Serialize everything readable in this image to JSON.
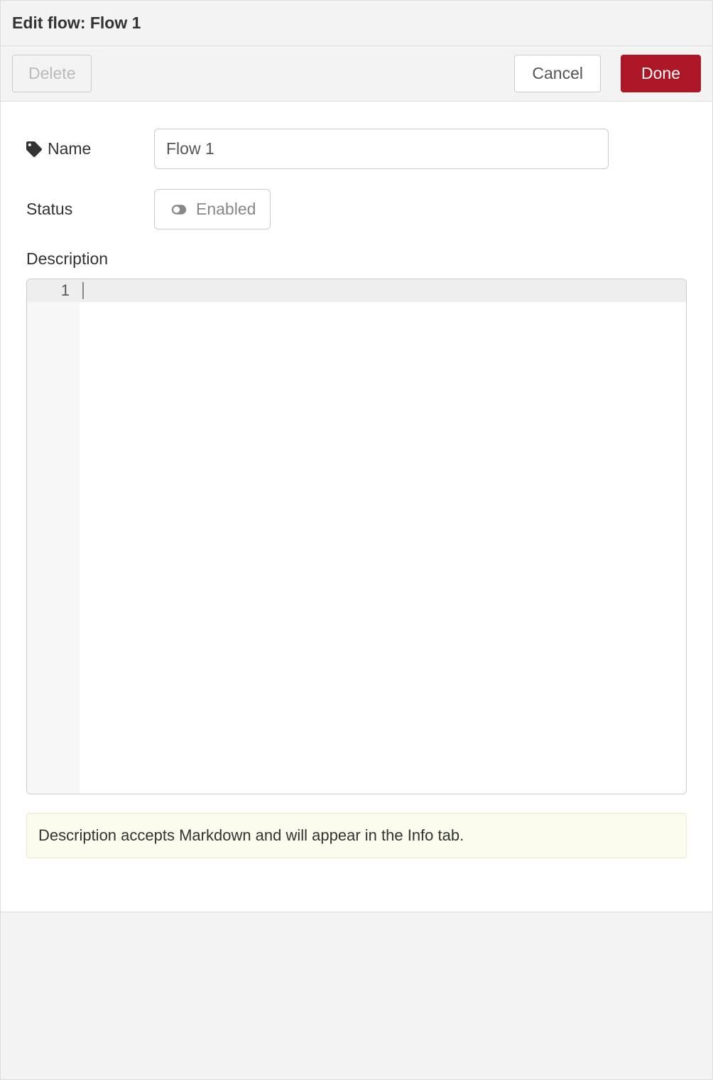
{
  "header": {
    "title": "Edit flow: Flow 1"
  },
  "toolbar": {
    "delete_label": "Delete",
    "cancel_label": "Cancel",
    "done_label": "Done"
  },
  "form": {
    "name_label": "Name",
    "name_value": "Flow 1",
    "status_label": "Status",
    "status_toggle_label": "Enabled",
    "description_label": "Description",
    "editor_line_number": "1",
    "info_text": "Description accepts Markdown and will appear in the Info tab."
  }
}
